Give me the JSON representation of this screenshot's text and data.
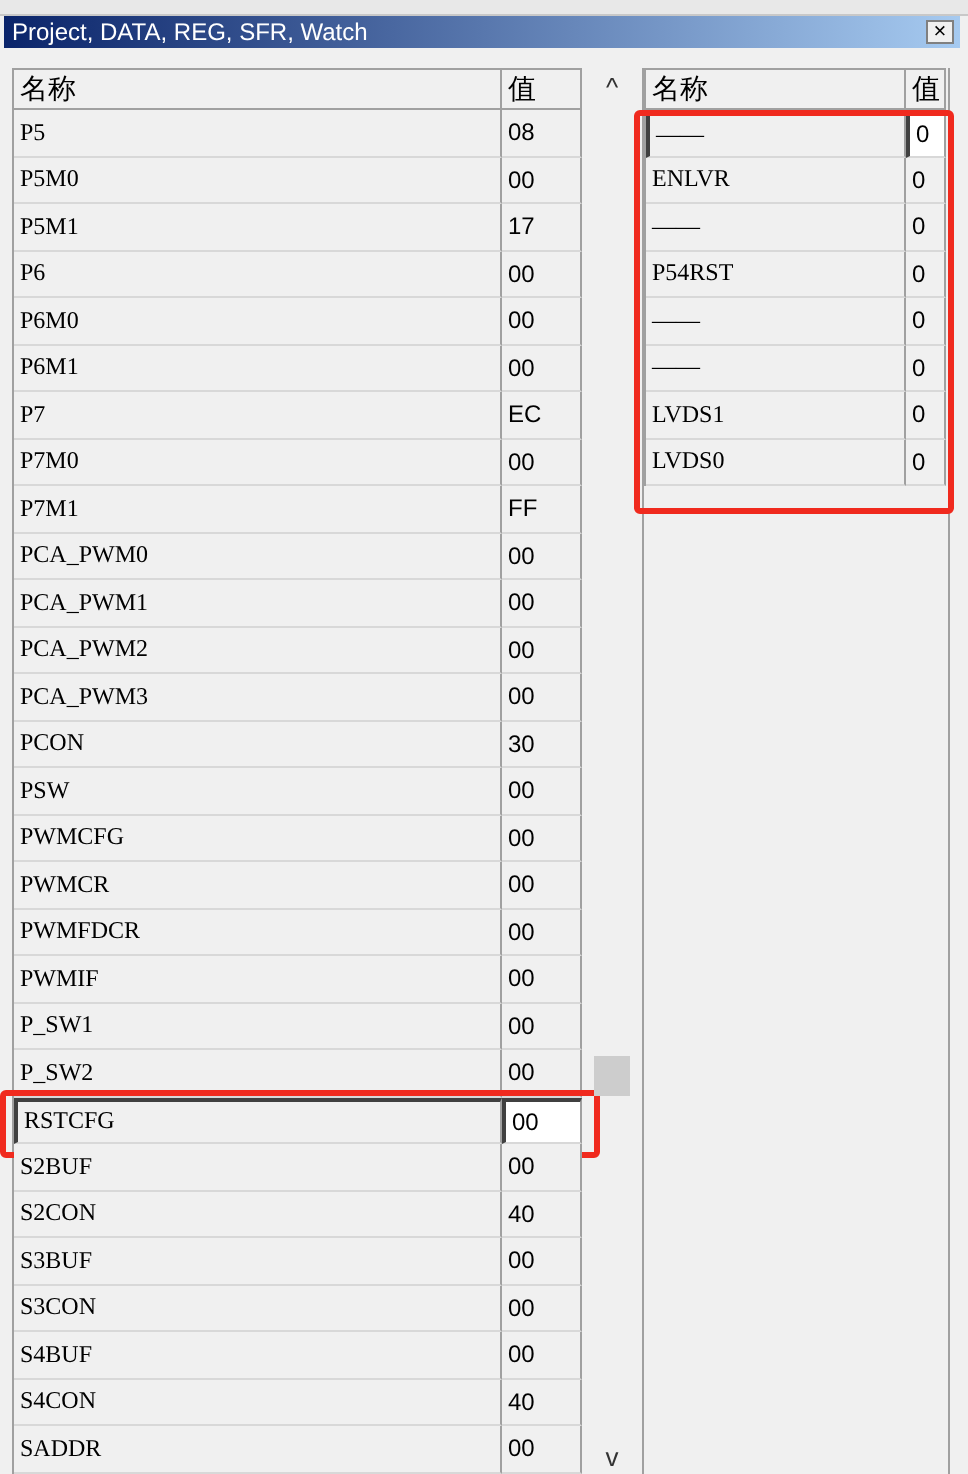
{
  "window": {
    "title": "Project, DATA, REG, SFR, Watch",
    "close": "×"
  },
  "left_table": {
    "columns": [
      "名称",
      "值"
    ],
    "scroll_up": "^",
    "scroll_down": "v",
    "rows": [
      {
        "name": "P5",
        "value": "08",
        "selected": false,
        "highlighted": false
      },
      {
        "name": "P5M0",
        "value": "00",
        "selected": false,
        "highlighted": false
      },
      {
        "name": "P5M1",
        "value": "17",
        "selected": false,
        "highlighted": false
      },
      {
        "name": "P6",
        "value": "00",
        "selected": false,
        "highlighted": false
      },
      {
        "name": "P6M0",
        "value": "00",
        "selected": false,
        "highlighted": false
      },
      {
        "name": "P6M1",
        "value": "00",
        "selected": false,
        "highlighted": false
      },
      {
        "name": "P7",
        "value": "EC",
        "selected": false,
        "highlighted": false
      },
      {
        "name": "P7M0",
        "value": "00",
        "selected": false,
        "highlighted": false
      },
      {
        "name": "P7M1",
        "value": "FF",
        "selected": false,
        "highlighted": false
      },
      {
        "name": "PCA_PWM0",
        "value": "00",
        "selected": false,
        "highlighted": false
      },
      {
        "name": "PCA_PWM1",
        "value": "00",
        "selected": false,
        "highlighted": false
      },
      {
        "name": "PCA_PWM2",
        "value": "00",
        "selected": false,
        "highlighted": false
      },
      {
        "name": "PCA_PWM3",
        "value": "00",
        "selected": false,
        "highlighted": false
      },
      {
        "name": "PCON",
        "value": "30",
        "selected": false,
        "highlighted": false
      },
      {
        "name": "PSW",
        "value": "00",
        "selected": false,
        "highlighted": false
      },
      {
        "name": "PWMCFG",
        "value": "00",
        "selected": false,
        "highlighted": false
      },
      {
        "name": "PWMCR",
        "value": "00",
        "selected": false,
        "highlighted": false
      },
      {
        "name": "PWMFDCR",
        "value": "00",
        "selected": false,
        "highlighted": false
      },
      {
        "name": "PWMIF",
        "value": "00",
        "selected": false,
        "highlighted": false
      },
      {
        "name": "P_SW1",
        "value": "00",
        "selected": false,
        "highlighted": false
      },
      {
        "name": "P_SW2",
        "value": "00",
        "selected": false,
        "highlighted": false
      },
      {
        "name": "RSTCFG",
        "value": "00",
        "selected": true,
        "highlighted": true
      },
      {
        "name": "S2BUF",
        "value": "00",
        "selected": false,
        "highlighted": false
      },
      {
        "name": "S2CON",
        "value": "40",
        "selected": false,
        "highlighted": false
      },
      {
        "name": "S3BUF",
        "value": "00",
        "selected": false,
        "highlighted": false
      },
      {
        "name": "S3CON",
        "value": "00",
        "selected": false,
        "highlighted": false
      },
      {
        "name": "S4BUF",
        "value": "00",
        "selected": false,
        "highlighted": false
      },
      {
        "name": "S4CON",
        "value": "40",
        "selected": false,
        "highlighted": false
      },
      {
        "name": "SADDR",
        "value": "00",
        "selected": false,
        "highlighted": false
      }
    ]
  },
  "right_table": {
    "columns": [
      "名称",
      "值"
    ],
    "highlighted": true,
    "rows": [
      {
        "name": "——",
        "value": "0",
        "selected": true
      },
      {
        "name": "ENLVR",
        "value": "0",
        "selected": false
      },
      {
        "name": "——",
        "value": "0",
        "selected": false
      },
      {
        "name": "P54RST",
        "value": "0",
        "selected": false
      },
      {
        "name": "——",
        "value": "0",
        "selected": false
      },
      {
        "name": "——",
        "value": "0",
        "selected": false
      },
      {
        "name": "LVDS1",
        "value": "0",
        "selected": false
      },
      {
        "name": "LVDS0",
        "value": "0",
        "selected": false
      }
    ]
  }
}
